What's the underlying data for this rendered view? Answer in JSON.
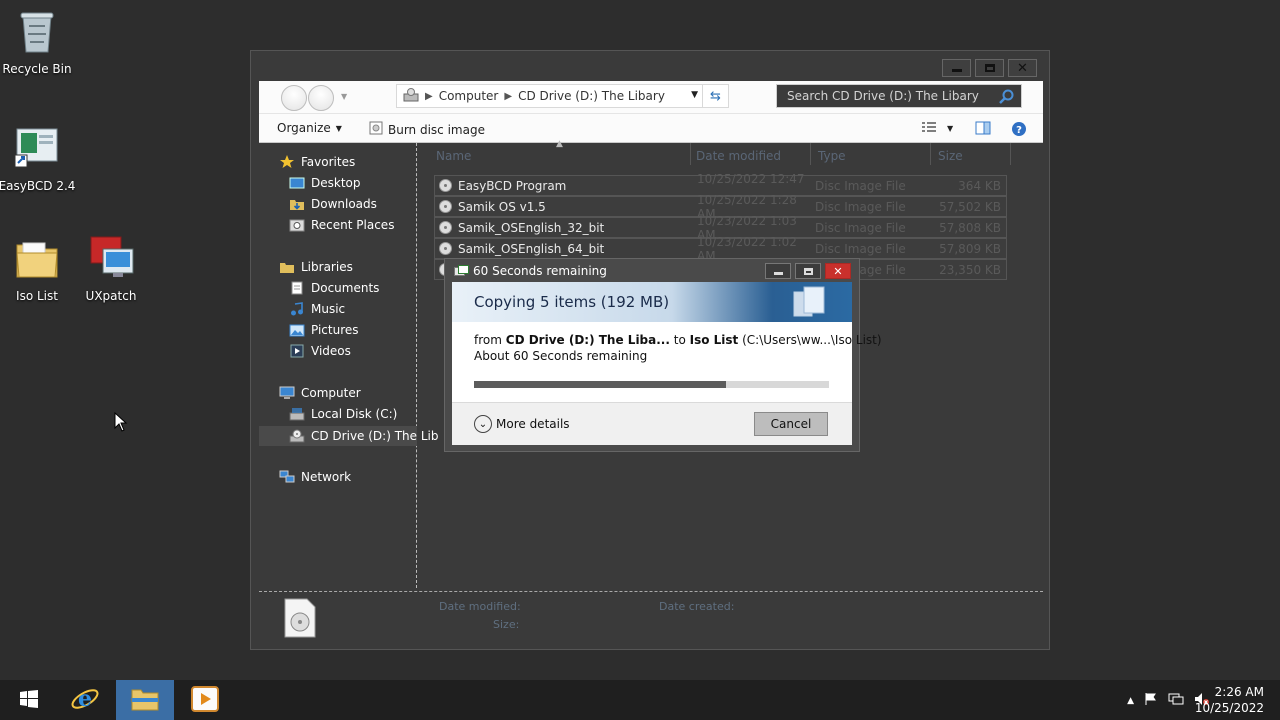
{
  "desktop": {
    "icons": [
      {
        "label": "Recycle Bin",
        "icon": "recycle-bin-icon"
      },
      {
        "label": "EasyBCD 2.4",
        "icon": "easybcd-icon"
      },
      {
        "label": "Iso List",
        "icon": "folder-icon"
      },
      {
        "label": "UXpatch",
        "icon": "uxpatch-icon"
      }
    ]
  },
  "explorer": {
    "address": {
      "segments": [
        "Computer",
        "CD Drive (D:) The Libary"
      ]
    },
    "search": {
      "placeholder": "Search CD Drive (D:) The Libary"
    },
    "toolbar": {
      "organize": "Organize",
      "burn": "Burn disc image"
    },
    "nav": {
      "favorites": "Favorites",
      "desktop": "Desktop",
      "downloads": "Downloads",
      "recent": "Recent Places",
      "libraries": "Libraries",
      "documents": "Documents",
      "music": "Music",
      "pictures": "Pictures",
      "videos": "Videos",
      "computer": "Computer",
      "local_disk": "Local Disk (C:)",
      "cd_drive": "CD Drive (D:) The Lib",
      "network": "Network"
    },
    "columns": {
      "name": "Name",
      "date": "Date modified",
      "type": "Type",
      "size": "Size"
    },
    "files": [
      {
        "name": "EasyBCD Program",
        "date": "10/25/2022 12:47 ...",
        "type": "Disc Image File",
        "size": "364 KB"
      },
      {
        "name": "Samik OS v1.5",
        "date": "10/25/2022 1:28 AM",
        "type": "Disc Image File",
        "size": "57,502 KB"
      },
      {
        "name": "Samik_OSEnglish_32_bit",
        "date": "10/23/2022 1:03 AM",
        "type": "Disc Image File",
        "size": "57,808 KB"
      },
      {
        "name": "Samik_OSEnglish_64_bit",
        "date": "10/23/2022 1:02 AM",
        "type": "Disc Image File",
        "size": "57,809 KB"
      },
      {
        "name": "",
        "date": "",
        "type": "Disc Image File",
        "size": "23,350 KB"
      }
    ],
    "details": {
      "date_modified": "Date modified:",
      "date_created": "Date created:",
      "size": "Size:"
    }
  },
  "copy_dialog": {
    "title": "60 Seconds remaining",
    "headline": "Copying 5 items (192 MB)",
    "from_word": "from",
    "source": "CD Drive (D:) The Liba...",
    "to_word": "to",
    "dest_name": "Iso List",
    "dest_path": "(C:\\Users\\ww...\\Iso List)",
    "remaining": "About 60 Seconds remaining",
    "progress_fraction": 0.71,
    "more_details": "More details",
    "cancel": "Cancel"
  },
  "taskbar": {
    "time": "2:26 AM",
    "date": "10/25/2022"
  },
  "colors": {
    "taskbar_active": "#3b6ea5",
    "close_red": "#c9302c",
    "progress_fill": "#5c5c5c"
  }
}
